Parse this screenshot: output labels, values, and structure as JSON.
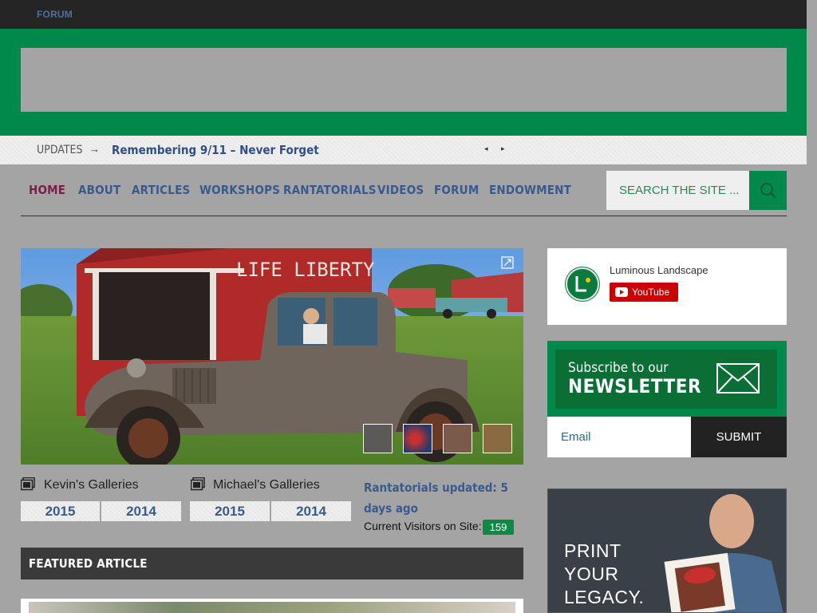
{
  "topbar": {
    "forum": "FORUM"
  },
  "ticker": {
    "label": "UPDATES",
    "arrow": "→",
    "headline": "Remembering 9/11 – Never Forget",
    "prev_icon": "◂",
    "next_icon": "▸"
  },
  "nav": {
    "items": [
      {
        "label": "HOME",
        "active": true
      },
      {
        "label": "ABOUT"
      },
      {
        "label": "ARTICLES"
      },
      {
        "label": "WORKSHOPS"
      },
      {
        "label": "RANTATORIALS"
      },
      {
        "label": "VIDEOS"
      },
      {
        "label": "FORUM"
      },
      {
        "label": "ENDOWMENT"
      }
    ]
  },
  "search": {
    "placeholder": "SEARCH THE SITE ..."
  },
  "galleries": [
    {
      "title": "Kevin's Galleries",
      "years": [
        "2015",
        "2014"
      ]
    },
    {
      "title": "Michael's Galleries",
      "years": [
        "2015",
        "2014"
      ]
    }
  ],
  "status": {
    "rantatorials": "Rantatorials updated: 5 days ago",
    "visitors_label": "Current Visitors on Site:",
    "visitors_count": "159"
  },
  "featured": {
    "title": "FEATURED ARTICLE"
  },
  "youtube_widget": {
    "name": "Luminous Landscape",
    "button": "YouTube"
  },
  "newsletter": {
    "line1": "Subscribe to our",
    "line2": "NEWSLETTER",
    "email_placeholder": "Email",
    "submit": "SUBMIT"
  },
  "ad": {
    "lines": [
      "PRINT",
      "YOUR",
      "LEGACY."
    ]
  },
  "hero": {
    "sign_text": "LIFE LIBERTY"
  },
  "colors": {
    "brand_green": "#00894a",
    "nav_blue": "#3b5a8c",
    "active_nav": "#7b1f4a"
  }
}
